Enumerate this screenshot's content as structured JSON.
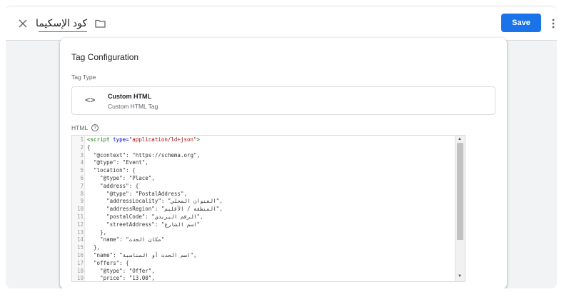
{
  "topbar": {
    "close_icon": "close-icon",
    "title": "كود الإسكيما",
    "folder_icon": "folder-icon",
    "save_label": "Save",
    "more_icon": "more-vert-icon"
  },
  "card": {
    "title": "Tag Configuration",
    "tag_type_label": "Tag Type",
    "tag_type": {
      "icon": "<>",
      "name": "Custom HTML",
      "subtitle": "Custom HTML Tag"
    },
    "html_label": "HTML",
    "help_icon": "?"
  },
  "editor": {
    "lines": [
      {
        "n": "1",
        "segments": [
          {
            "t": "<script ",
            "c": "tag"
          },
          {
            "t": "type=",
            "c": "attr"
          },
          {
            "t": "\"application/ld+json\"",
            "c": "str"
          },
          {
            "t": ">",
            "c": "tag"
          }
        ]
      },
      {
        "n": "2",
        "segments": [
          {
            "t": "{",
            "c": ""
          }
        ]
      },
      {
        "n": "3",
        "segments": [
          {
            "t": "  \"@context\": \"https://schema.org\",",
            "c": ""
          }
        ]
      },
      {
        "n": "4",
        "segments": [
          {
            "t": "  \"@type\": \"Event\",",
            "c": ""
          }
        ]
      },
      {
        "n": "5",
        "segments": [
          {
            "t": "  \"location\": {",
            "c": ""
          }
        ]
      },
      {
        "n": "6",
        "segments": [
          {
            "t": "    \"@type\": \"Place\",",
            "c": ""
          }
        ]
      },
      {
        "n": "7",
        "segments": [
          {
            "t": "    \"address\": {",
            "c": ""
          }
        ]
      },
      {
        "n": "8",
        "segments": [
          {
            "t": "      \"@type\": \"PostalAddress\",",
            "c": ""
          }
        ]
      },
      {
        "n": "9",
        "segments": [
          {
            "t": "      \"addressLocality\": \"العنوان المحلي\",",
            "c": ""
          }
        ]
      },
      {
        "n": "10",
        "segments": [
          {
            "t": "      \"addressRegion\": \"المنطقة / الأقليم\",",
            "c": ""
          }
        ]
      },
      {
        "n": "11",
        "segments": [
          {
            "t": "      \"postalCode\": \"الرقم البريدي\",",
            "c": ""
          }
        ]
      },
      {
        "n": "12",
        "segments": [
          {
            "t": "      \"streetAddress\": \"اسم الشارع\"",
            "c": ""
          }
        ]
      },
      {
        "n": "13",
        "segments": [
          {
            "t": "    },",
            "c": ""
          }
        ]
      },
      {
        "n": "14",
        "segments": [
          {
            "t": "    \"name\": \"مكان الحدث\"",
            "c": ""
          }
        ]
      },
      {
        "n": "15",
        "segments": [
          {
            "t": "  },",
            "c": ""
          }
        ]
      },
      {
        "n": "16",
        "segments": [
          {
            "t": "  \"name\": \"اسم الحدث أو المناسبة\",",
            "c": ""
          }
        ]
      },
      {
        "n": "17",
        "segments": [
          {
            "t": "  \"offers\": {",
            "c": ""
          }
        ]
      },
      {
        "n": "18",
        "segments": [
          {
            "t": "    \"@type\": \"Offer\",",
            "c": ""
          }
        ]
      },
      {
        "n": "19",
        "segments": [
          {
            "t": "    \"price\": \"13.00\",",
            "c": ""
          }
        ]
      }
    ],
    "scroll_up_icon": "▲",
    "scroll_down_icon": "▼"
  },
  "colors": {
    "accent": "#1a73e8",
    "background": "#f1f3f4"
  }
}
